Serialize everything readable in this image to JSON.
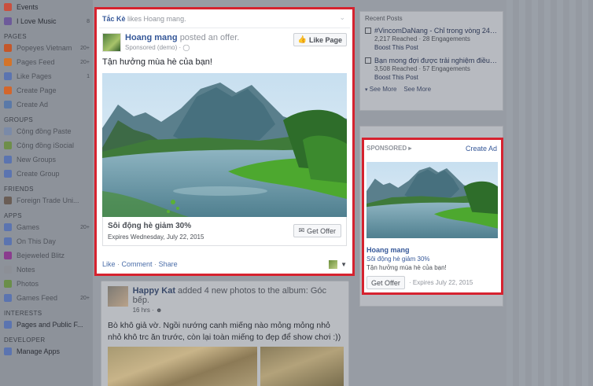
{
  "sidebar": {
    "top_items": [
      {
        "label": "Events",
        "count": "",
        "color": "#c9503f"
      },
      {
        "label": "I Love Music",
        "count": "8",
        "color": "#6d5a9a"
      }
    ],
    "pages_header": "PAGES",
    "pages_items": [
      {
        "label": "Popeyes Vietnam",
        "count": "20+",
        "color": "#c4572a"
      },
      {
        "label": "Pages Feed",
        "count": "20+",
        "color": "#d4742a"
      },
      {
        "label": "Like Pages",
        "count": "1",
        "color": "#5b74b0"
      },
      {
        "label": "Create Page",
        "count": "",
        "color": "#d3662b"
      },
      {
        "label": "Create Ad",
        "count": "",
        "color": "#5a79a8"
      }
    ],
    "groups_header": "GROUPS",
    "groups_items": [
      {
        "label": "Cộng đồng Paste",
        "count": "",
        "color": "#7a8aa8"
      },
      {
        "label": "Cộng đồng iSocial",
        "count": "",
        "color": "#6e8e4a"
      },
      {
        "label": "New Groups",
        "count": "",
        "color": "#5b74b0"
      },
      {
        "label": "Create Group",
        "count": "",
        "color": "#5b74b0"
      }
    ],
    "friends_header": "FRIENDS",
    "friends_items": [
      {
        "label": "Foreign Trade Uni...",
        "count": "",
        "color": "#6a5d55"
      }
    ],
    "apps_header": "APPS",
    "apps_items": [
      {
        "label": "Games",
        "count": "20+",
        "color": "#5b74b0"
      },
      {
        "label": "On This Day",
        "count": "",
        "color": "#5b74b0"
      },
      {
        "label": "Bejeweled Blitz",
        "count": "",
        "color": "#8a3c8e"
      },
      {
        "label": "Notes",
        "count": "",
        "color": "#8c8f96"
      },
      {
        "label": "Photos",
        "count": "",
        "color": "#6a8e4a"
      },
      {
        "label": "Games Feed",
        "count": "20+",
        "color": "#5b74b0"
      }
    ],
    "interests_header": "INTERESTS",
    "interests_items": [
      {
        "label": "Pages and Public F...",
        "count": "",
        "color": "#5b74b0"
      }
    ],
    "developer_header": "DEVELOPER",
    "developer_items": [
      {
        "label": "Manage Apps",
        "count": "",
        "color": "#5b74b0"
      }
    ]
  },
  "ad_post": {
    "liker": "Tắc Kè",
    "liker_suffix": "likes Hoang mang.",
    "page_name": "Hoang mang",
    "action": "posted an offer.",
    "sponsored": "Sponsored (demo) ·",
    "like_page_label": "Like Page",
    "text": "Tận hưởng mùa hè của bạn!",
    "offer_title": "Sôi động hè giảm 30%",
    "offer_expires": "Expires Wednesday, July 22, 2015",
    "get_offer_label": "Get Offer",
    "like": "Like",
    "comment": "Comment",
    "share": "Share"
  },
  "recent_posts": {
    "title": "Recent Posts",
    "items": [
      {
        "title": "#VincomDaNang - Chỉ trong vòng 24h, ...",
        "stats": "2,217 Reached  ·  28 Engagements",
        "boost": "Boost This Post"
      },
      {
        "title": "Bạn mong đợi được trải nghiệm điều g...",
        "stats": "3,508 Reached  ·  57 Engagements",
        "boost": "Boost This Post"
      }
    ],
    "see_more_1": "See More",
    "see_more_2": "See More"
  },
  "sponsored_ad": {
    "label": "SPONSORED",
    "create_ad": "Create Ad",
    "name": "Hoang mang",
    "desc": "Sôi động hè giảm 30%",
    "desc2": "Tận hưởng mùa hè của bạn!",
    "button": "Get Offer",
    "expires": "· Expires July 22, 2015"
  },
  "story2": {
    "name": "Happy Kat",
    "action": "added 4 new photos to the album: Góc bếp.",
    "time": "16 hrs ·",
    "text": "Bò khô giả vờ. Ngồi nướng canh miếng nào mỏng mỏng nhỏ nhỏ khô trc ăn trước, còn lại toàn miếng to đẹp để show chơi :))"
  },
  "colors": {
    "highlight": "#d6222f",
    "link": "#365899"
  }
}
